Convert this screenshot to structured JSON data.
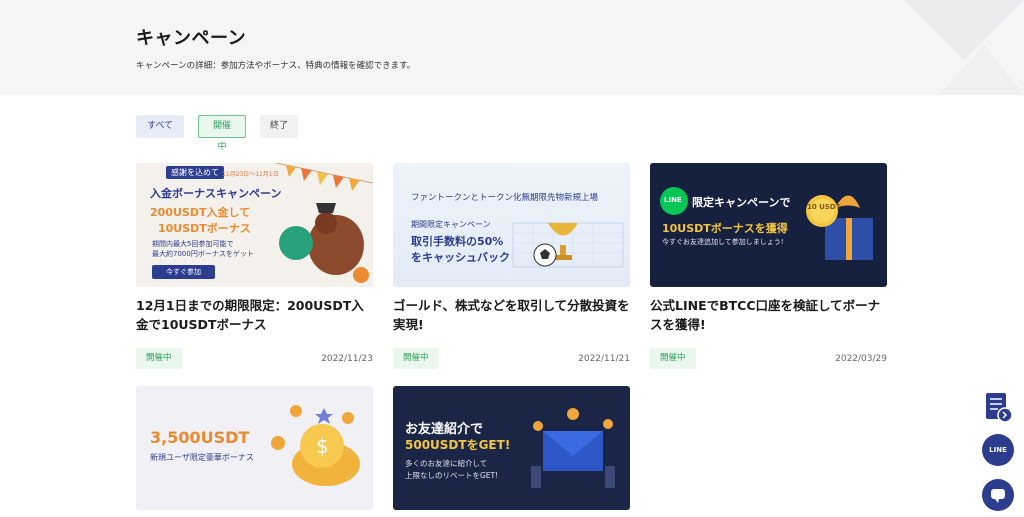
{
  "header": {
    "title": "キャンペーン",
    "subtitle": "キャンペーンの詳細：参加方法やボーナス、特典の情報を確認できます。"
  },
  "filters": [
    {
      "label": "すべて"
    },
    {
      "label": "開催中"
    },
    {
      "label": "終了"
    }
  ],
  "cards": [
    {
      "title": "12月1日までの期限限定：200USDT入金で10USDTボーナス",
      "status": "開催中",
      "date": "2022/11/23",
      "banner": {
        "tag": "感謝を込めて",
        "period": "11月23日〜12月1日",
        "heading": "入金ボーナスキャンペーン",
        "line1": "200USDT入金して",
        "line2": "10USDTボーナス",
        "note1": "期間内最大5回参加可能で",
        "note2": "最大約7000円ボーナスをゲット",
        "button": "今すぐ参加"
      }
    },
    {
      "title": "ゴールド、株式などを取引して分散投資を実現!",
      "status": "開催中",
      "date": "2022/11/21",
      "banner": {
        "heading": "ファントークンとトークン化無期限先物新規上場",
        "line1": "期間限定キャンペーン",
        "line2": "取引手数料の50%",
        "line3": "をキャッシュバック"
      }
    },
    {
      "title": "公式LINEでBTCC口座を検証してボーナスを獲得!",
      "status": "開催中",
      "date": "2022/03/29",
      "banner": {
        "logo": "LINE",
        "heading": "限定キャンペーンで",
        "line1": "10USDTボーナスを獲得",
        "line2": "今すぐお友達追加して参加しましょう!",
        "coin": "10 USDT"
      }
    },
    {
      "title": "",
      "status": "",
      "date": "",
      "banner": {
        "heading": "3,500USDT",
        "line1": "新規ユーザ限定豪華ボーナス"
      }
    },
    {
      "title": "",
      "status": "",
      "date": "",
      "banner": {
        "heading": "お友達紹介で",
        "line1": "500USDTをGET!",
        "line2": "多くのお友達に紹介して",
        "line3": "上限なしのリベートをGET!"
      }
    }
  ],
  "side": {
    "line_label": "LINE"
  },
  "colors": {
    "accent": "#2c3d8f",
    "status_green": "#2f9c55",
    "hero_bg": "#f5f5f6"
  }
}
